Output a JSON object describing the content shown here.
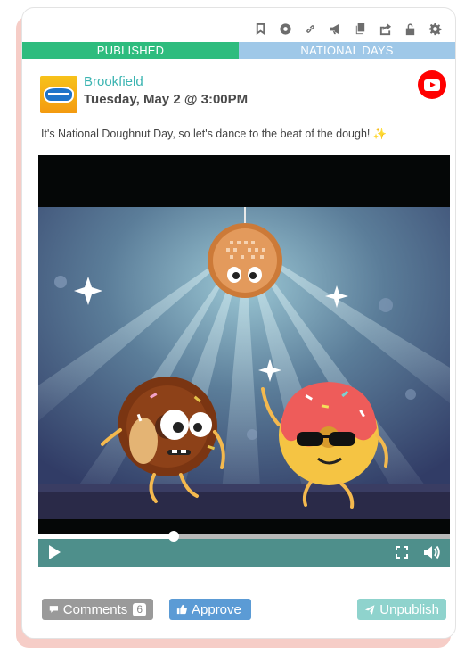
{
  "toolbar": {
    "icons": [
      "bookmark-icon",
      "circle-icon",
      "link-icon",
      "megaphone-icon",
      "copy-icon",
      "share-icon",
      "unlock-icon",
      "gear-icon"
    ]
  },
  "status": {
    "state": "PUBLISHED",
    "category": "NATIONAL DAYS",
    "state_color": "#2ebc7e",
    "category_color": "#9fc8e8"
  },
  "post": {
    "account_name": "Brookfield",
    "datetime": "Tuesday, May 2 @ 3:00PM",
    "network": "youtube",
    "text": "It's National Doughnut Day, so let's dance to the beat of the dough! ",
    "emoji": "✨"
  },
  "video": {
    "progress_fraction": 0.33
  },
  "actions": {
    "comments_label": "Comments",
    "comments_count": "6",
    "approve_label": "Approve",
    "unpublish_label": "Unpublish"
  }
}
